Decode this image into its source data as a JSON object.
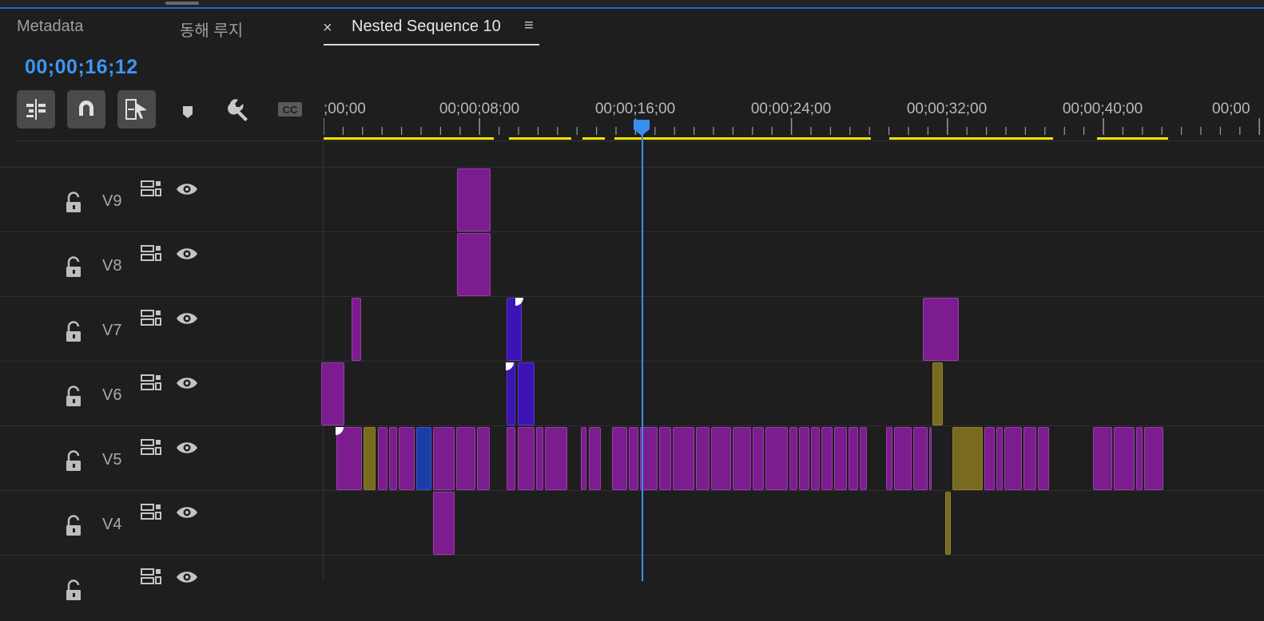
{
  "tabs": {
    "metadata": "Metadata",
    "korean": "동해 루지",
    "active": "Nested Sequence 10",
    "close_glyph": "×",
    "menu_glyph": "≡"
  },
  "timecode": "00;00;16;12",
  "toolbar": {
    "tools": [
      {
        "name": "insert-overwrite-sequences-icon",
        "active": true
      },
      {
        "name": "snap-magnet-icon",
        "active": true
      },
      {
        "name": "linked-selection-icon",
        "active": true
      },
      {
        "name": "add-marker-icon",
        "active": false
      },
      {
        "name": "timeline-settings-wrench-icon",
        "active": false
      },
      {
        "name": "captions-cc-icon",
        "active": false
      }
    ]
  },
  "ruler": {
    "labels": [
      ";00;00",
      "00;00;08;00",
      "00;00;16;00",
      "00;00;24;00",
      "00;00;32;00",
      "00;00;40;00",
      "00;00"
    ]
  },
  "playhead": {
    "time": "00;00;16;12",
    "color": "#3a8ef0"
  },
  "tracks": [
    {
      "label": "V9"
    },
    {
      "label": "V8"
    },
    {
      "label": "V7"
    },
    {
      "label": "V6"
    },
    {
      "label": "V5"
    },
    {
      "label": "V4"
    },
    {
      "label": ""
    }
  ],
  "colors": {
    "accent": "#3d96f3",
    "clip_purple": "#7b1d8e",
    "clip_violet": "#3d14b3",
    "clip_blue": "#1a3da8",
    "clip_olive": "#786a1f",
    "render_bar": "#f2e600"
  }
}
